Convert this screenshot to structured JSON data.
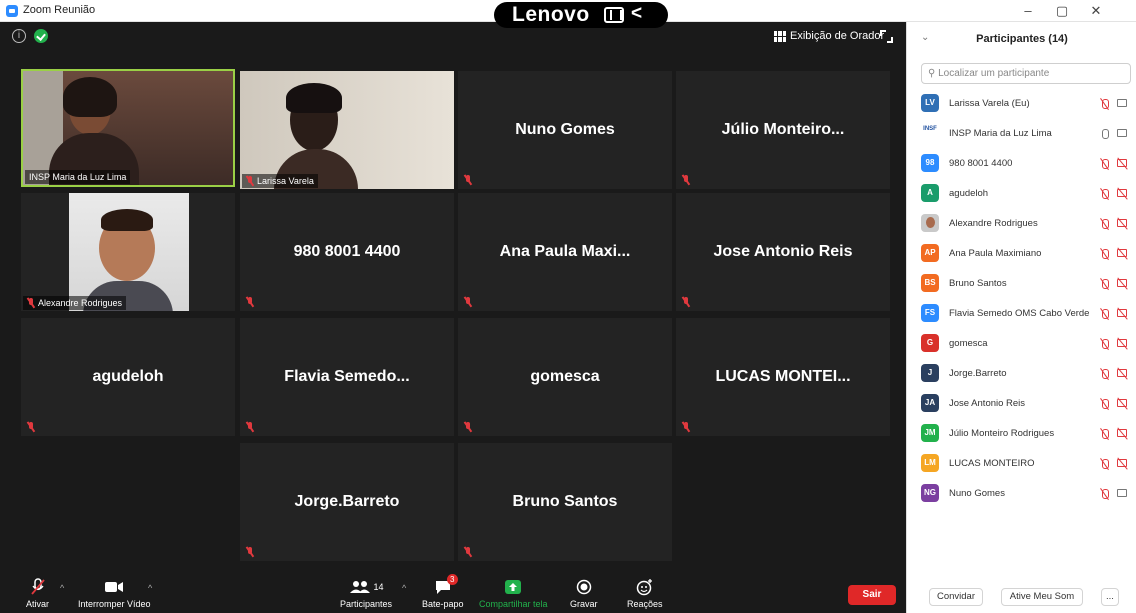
{
  "window": {
    "title": "Zoom Reunião",
    "brand_pill": "Lenovo",
    "controls": {
      "minimize": "–",
      "restore": "▢",
      "close": "✕"
    }
  },
  "meeting": {
    "speaker_view_label": "Exibição de Orador",
    "tiles": [
      {
        "name": "INSP Maria da Luz Lima",
        "video": true,
        "active": true
      },
      {
        "name": "Larissa Varela",
        "video": true
      },
      {
        "name": "Nuno Gomes",
        "video": false
      },
      {
        "name": "Júlio Monteiro...",
        "video": false
      },
      {
        "name": "Alexandre Rodrigues",
        "video": true
      },
      {
        "name": "980 8001 4400",
        "video": false
      },
      {
        "name": "Ana Paula Maxi...",
        "video": false
      },
      {
        "name": "Jose Antonio Reis",
        "video": false
      },
      {
        "name": "agudeloh",
        "video": false
      },
      {
        "name": "Flavia Semedo...",
        "video": false
      },
      {
        "name": "gomesca",
        "video": false
      },
      {
        "name": "LUCAS MONTEI...",
        "video": false
      },
      {
        "name": "Jorge.Barreto",
        "video": false
      },
      {
        "name": "Bruno Santos",
        "video": false
      }
    ]
  },
  "toolbar": {
    "unmute_label": "Ativar",
    "stop_video_label": "Interromper Vídeo",
    "participants_label": "Participantes",
    "participants_count": "14",
    "chat_label": "Bate-papo",
    "chat_badge": "3",
    "share_label": "Compartilhar tela",
    "record_label": "Gravar",
    "reactions_label": "Reações",
    "leave_label": "Sair",
    "colors": {
      "share": "#22b14c",
      "leave": "#e02828"
    }
  },
  "panel": {
    "title": "Participantes (14)",
    "search_placeholder": "Localizar um participante",
    "participants": [
      {
        "initials": "LV",
        "name": "Larissa Varela (Eu)",
        "color": "#2f6fb5",
        "mic": "muted",
        "cam": "on"
      },
      {
        "initials": "INSF",
        "name": "INSP Maria da Luz Lima",
        "color": "logo",
        "mic": "on",
        "cam": "on"
      },
      {
        "initials": "98",
        "name": "980 8001 4400",
        "color": "#2d8cff",
        "mic": "muted",
        "cam": "off"
      },
      {
        "initials": "A",
        "name": "agudeloh",
        "color": "#1a9c6b",
        "mic": "muted",
        "cam": "off"
      },
      {
        "initials": "",
        "name": "Alexandre Rodrigues",
        "color": "photo",
        "mic": "muted",
        "cam": "off"
      },
      {
        "initials": "AP",
        "name": "Ana Paula Maximiano",
        "color": "#f26b21",
        "mic": "muted",
        "cam": "off"
      },
      {
        "initials": "BS",
        "name": "Bruno Santos",
        "color": "#f26b21",
        "mic": "muted",
        "cam": "off"
      },
      {
        "initials": "FS",
        "name": "Flavia Semedo OMS Cabo Verde",
        "color": "#2d8cff",
        "mic": "muted",
        "cam": "off"
      },
      {
        "initials": "G",
        "name": "gomesca",
        "color": "#d9312a",
        "mic": "muted",
        "cam": "off"
      },
      {
        "initials": "J",
        "name": "Jorge.Barreto",
        "color": "#2a3f5f",
        "mic": "muted",
        "cam": "off"
      },
      {
        "initials": "JA",
        "name": "Jose Antonio Reis",
        "color": "#2a3f5f",
        "mic": "muted",
        "cam": "off"
      },
      {
        "initials": "JM",
        "name": "Júlio Monteiro Rodrigues",
        "color": "#22b14c",
        "mic": "muted",
        "cam": "off"
      },
      {
        "initials": "LM",
        "name": "LUCAS MONTEIRO",
        "color": "#f5a623",
        "mic": "muted",
        "cam": "off"
      },
      {
        "initials": "NG",
        "name": "Nuno Gomes",
        "color": "#7b3fa0",
        "mic": "muted",
        "cam": "on"
      }
    ],
    "invite_label": "Convidar",
    "unmute_me_label": "Ative Meu Som",
    "more_label": "..."
  }
}
